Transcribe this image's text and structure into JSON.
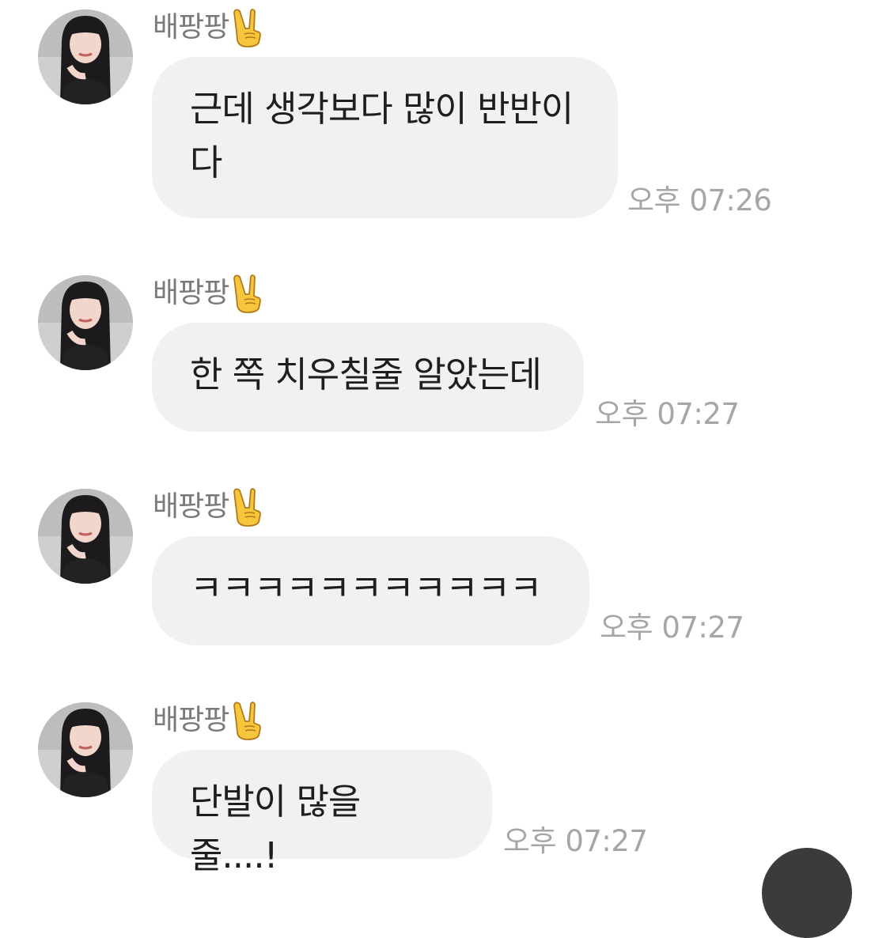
{
  "messages": [
    {
      "sender": "배팡팡",
      "sender_emoji": "victory-hand-emoji",
      "text": "근데 생각보다 많이 반반이\n다",
      "time": "오후 07:26"
    },
    {
      "sender": "배팡팡",
      "sender_emoji": "victory-hand-emoji",
      "text": "한 쪽 치우칠줄 알았는데",
      "time": "오후 07:27"
    },
    {
      "sender": "배팡팡",
      "sender_emoji": "victory-hand-emoji",
      "text": "ㅋㅋㅋㅋㅋㅋㅋㅋㅋㅋㅋ",
      "time": "오후 07:27"
    },
    {
      "sender": "배팡팡",
      "sender_emoji": "victory-hand-emoji",
      "text": "단발이 많을 줄....!",
      "time": "오후 07:27"
    }
  ],
  "colors": {
    "bubble": "#f1f1f3",
    "text": "#1e1e1e",
    "sender": "#7a7a7a",
    "timestamp": "#a6a6a6",
    "fab": "#3b3b3d"
  },
  "icons": {
    "avatar": "profile-photo",
    "fab": "floating-action-button"
  }
}
